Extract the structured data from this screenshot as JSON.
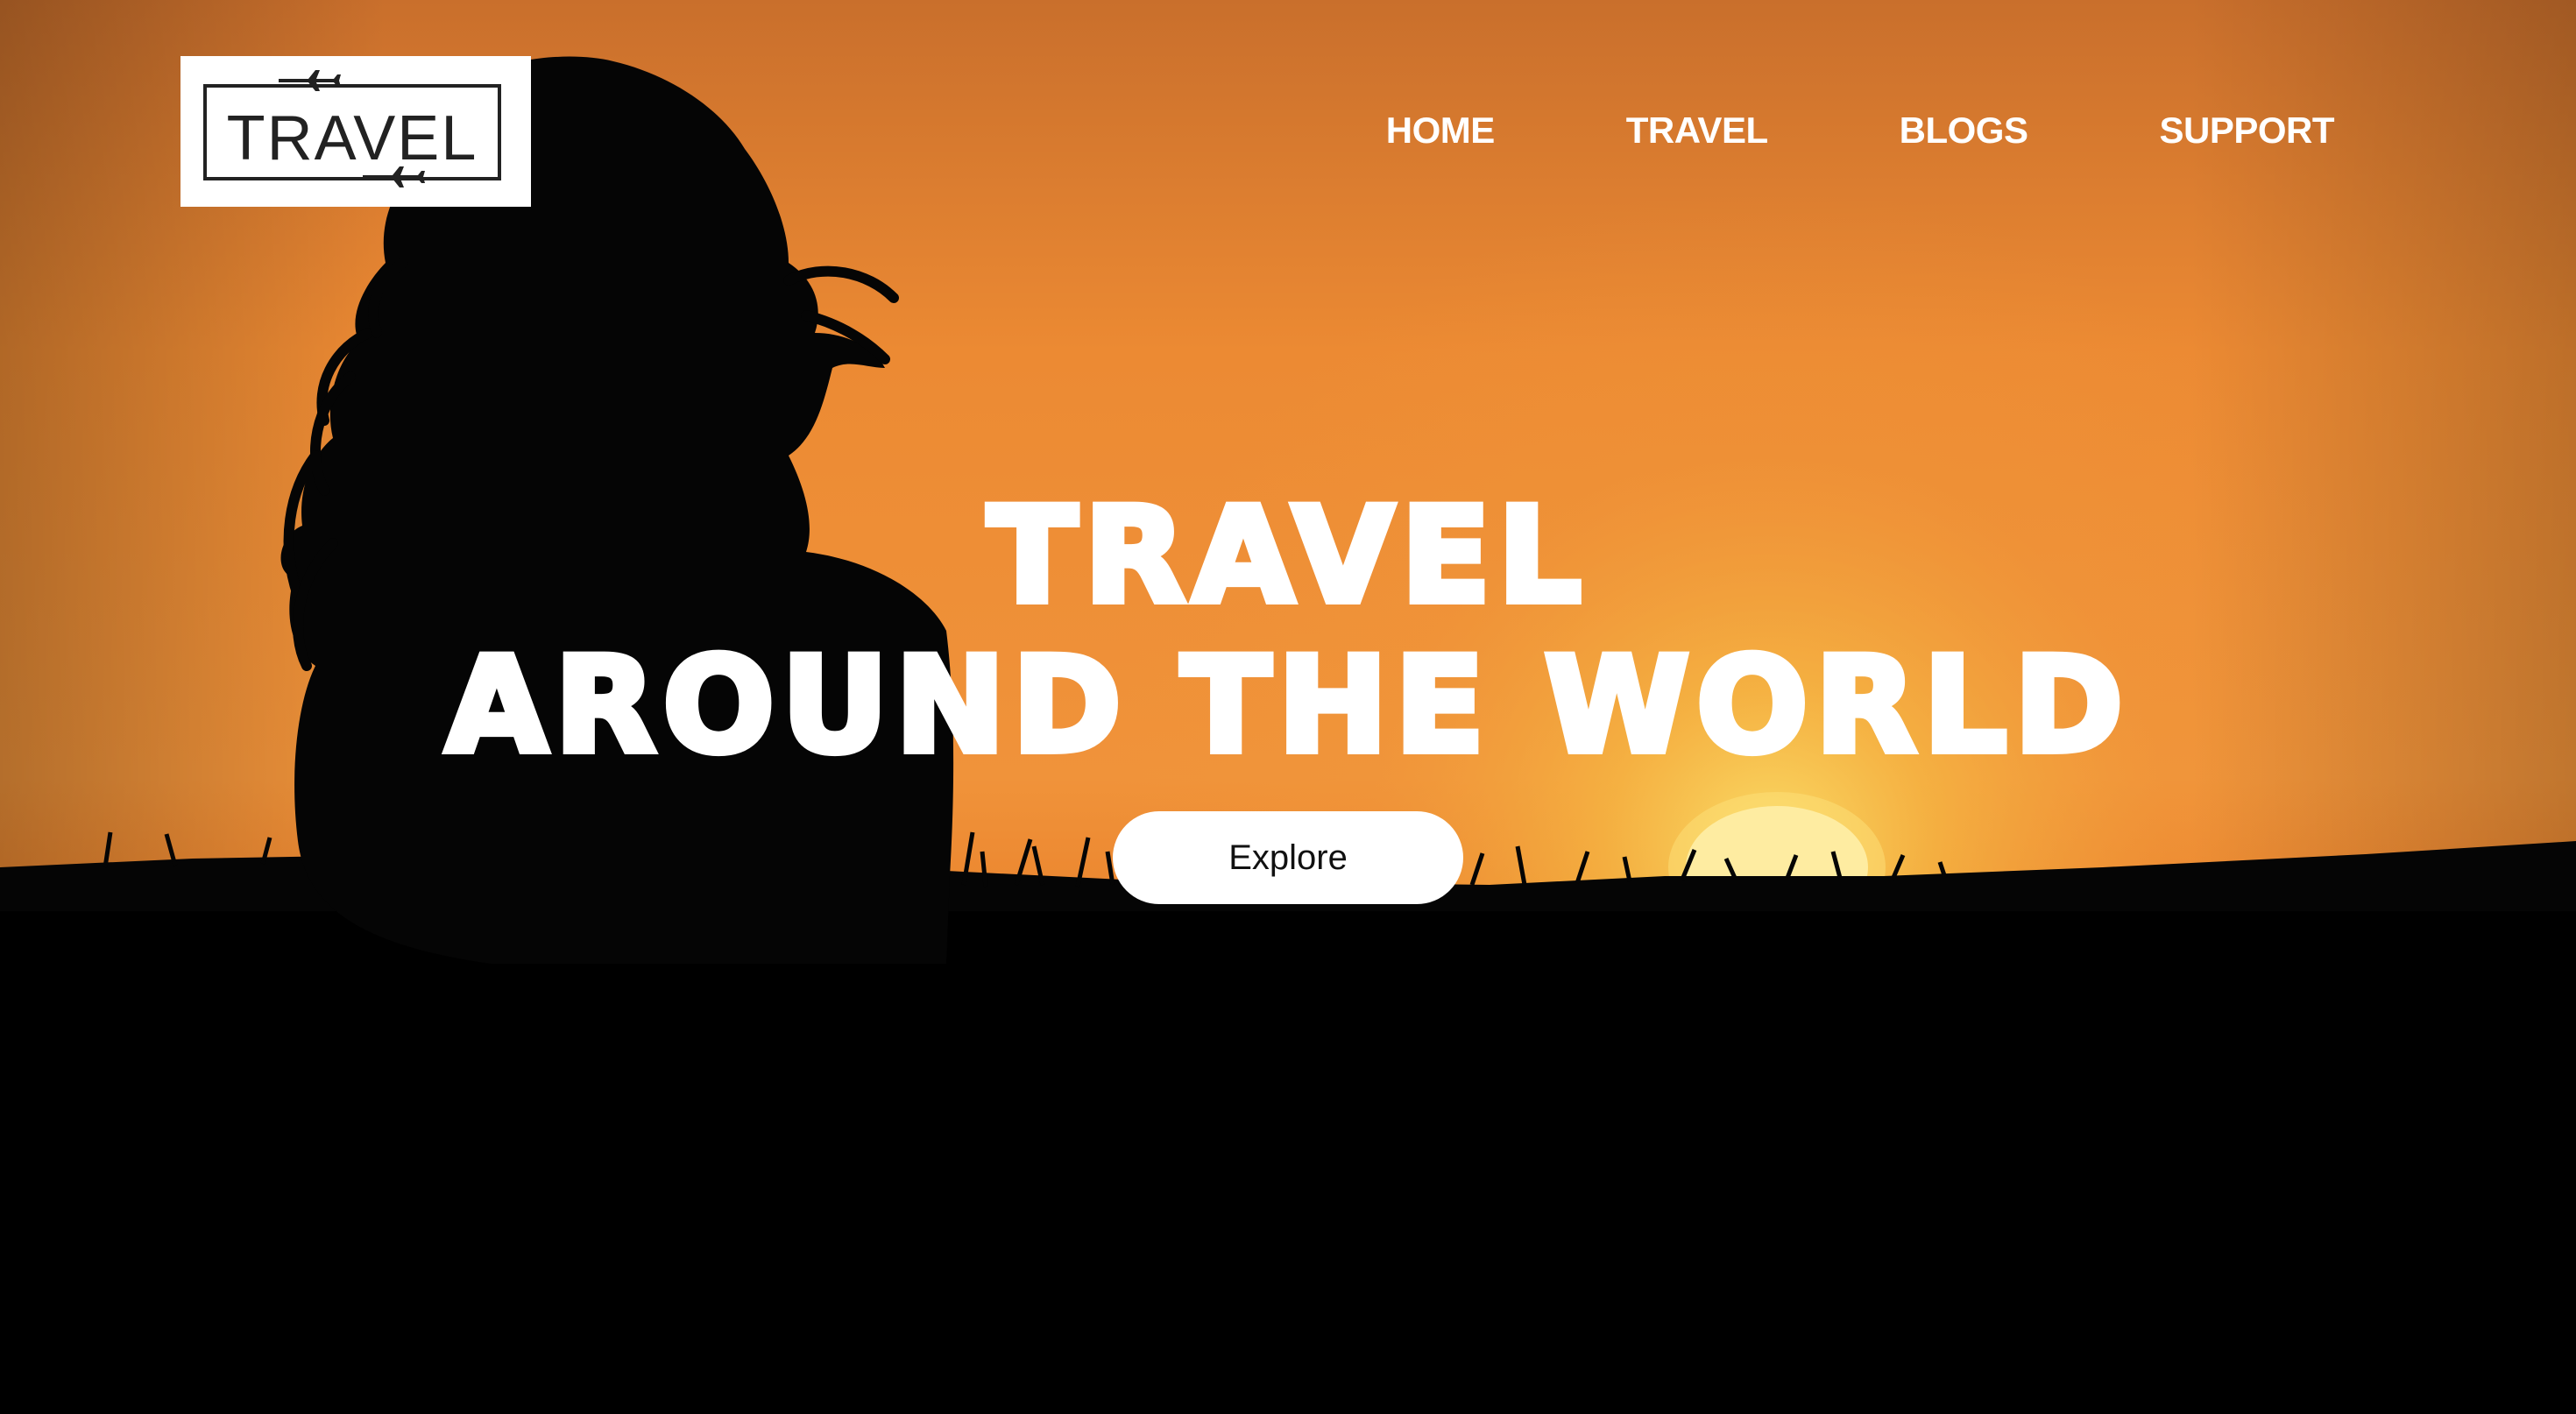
{
  "logo": {
    "text": "TRAVEL",
    "icon": "airplane-icon"
  },
  "nav": {
    "items": [
      {
        "label": "HOME"
      },
      {
        "label": "TRAVEL"
      },
      {
        "label": "BLOGS"
      },
      {
        "label": "SUPPORT"
      }
    ]
  },
  "hero": {
    "title_line1": "TRAVEL",
    "title_line2": "AROUND THE WORLD",
    "cta_label": "Explore"
  },
  "colors": {
    "sky_top": "#d9772c",
    "sky_mid": "#ef8f35",
    "sun": "#fde27a",
    "ground": "#000000",
    "text": "#ffffff"
  }
}
